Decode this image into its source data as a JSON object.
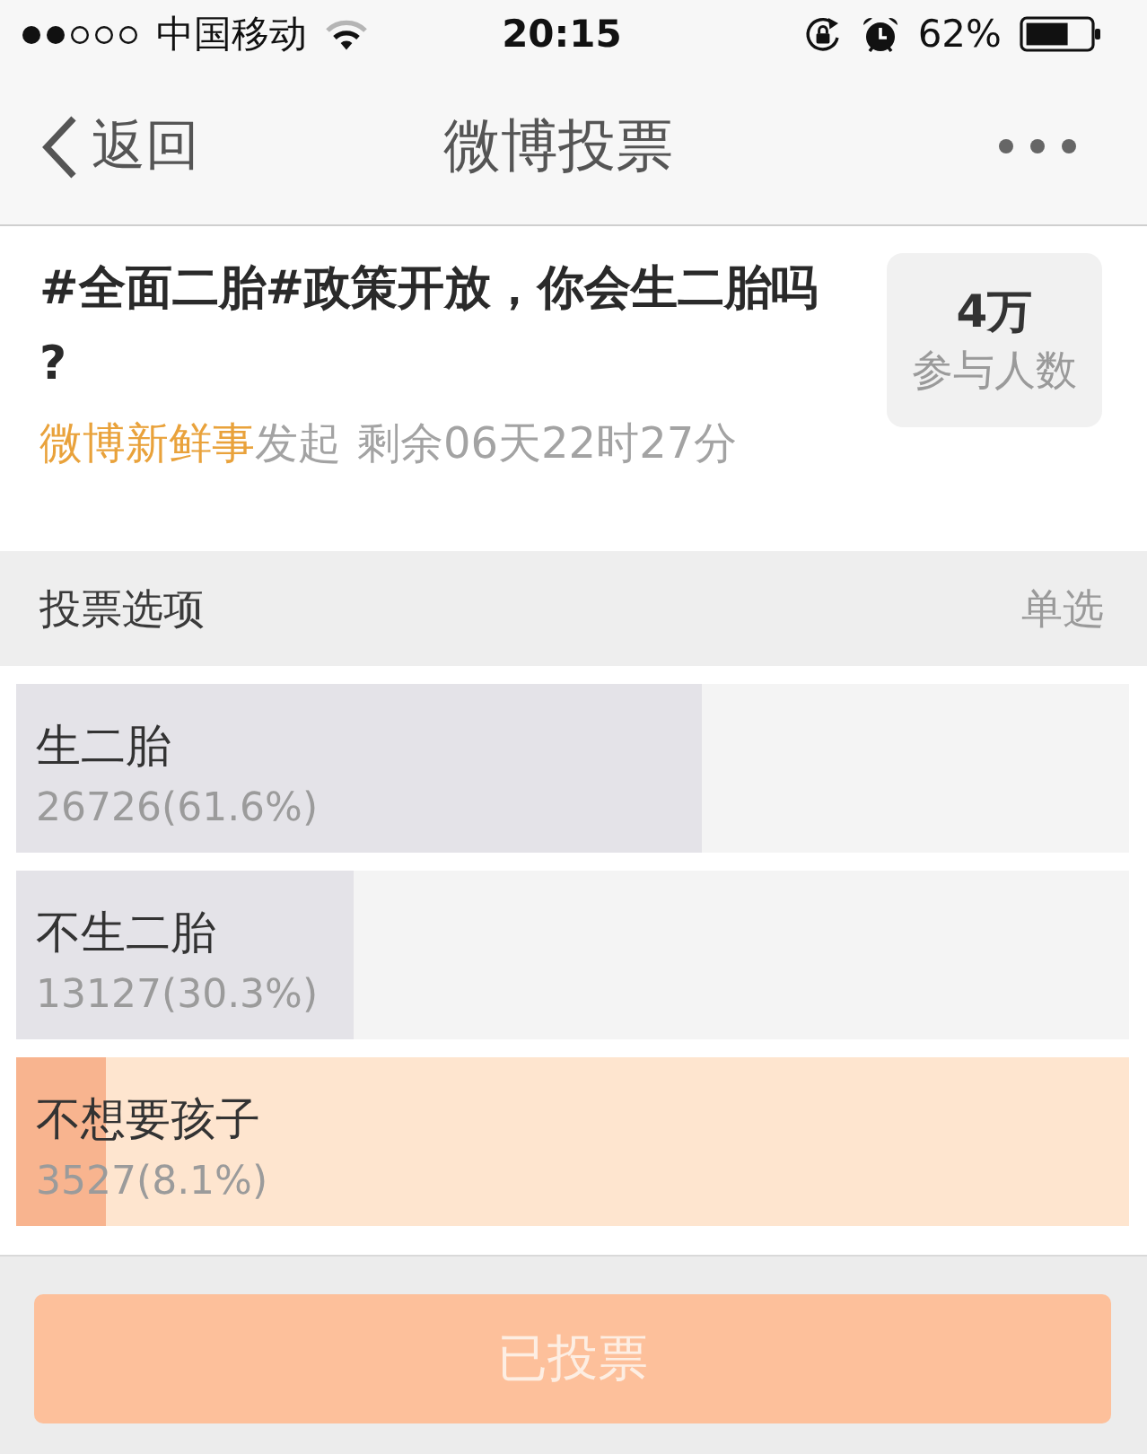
{
  "status_bar": {
    "carrier": "中国移动",
    "time": "20:15",
    "battery": "62%"
  },
  "nav_bar": {
    "back_label": "返回",
    "title": "微博投票"
  },
  "poll": {
    "question": "#全面二胎#政策开放，你会生二胎吗?",
    "initiator": "微博新鲜事",
    "action": "发起",
    "remaining": "剩余06天22时27分",
    "participants": {
      "count": "4万",
      "label": "参与人数"
    }
  },
  "options_header": {
    "title": "投票选项",
    "mode": "单选"
  },
  "options": [
    {
      "label": "生二胎",
      "result": "26726(61.6%)",
      "level": 0.616,
      "selected": false
    },
    {
      "label": "不生二胎",
      "result": "13127(30.3%)",
      "level": 0.303,
      "selected": false
    },
    {
      "label": "不想要孩子",
      "result": "3527(8.1%)",
      "level": 0.081,
      "selected": true
    }
  ],
  "vote_button": {
    "label": "已投票",
    "disabled": true
  }
}
